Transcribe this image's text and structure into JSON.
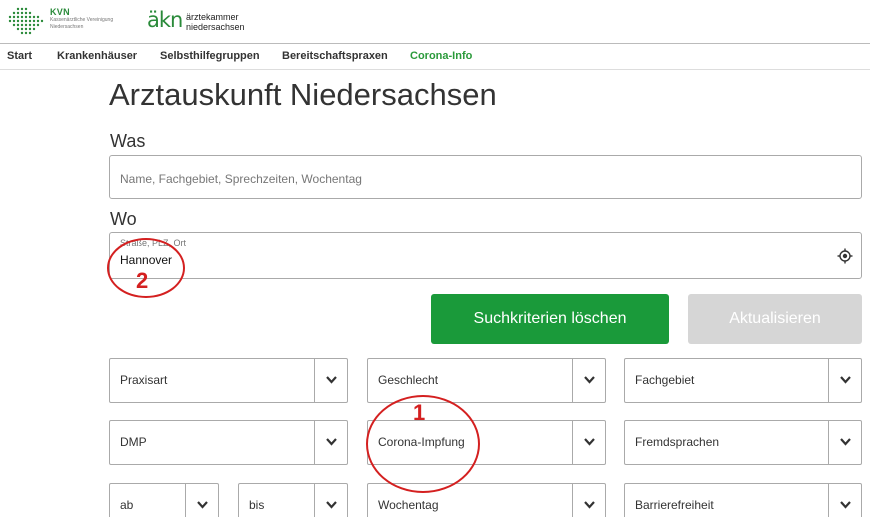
{
  "header": {
    "kvn_title": "KVN",
    "kvn_subtitle": "Kassenärztliche Vereinigung Niedersachsen",
    "akn_mark": "äkn",
    "akn_line1": "ärztekammer",
    "akn_line2": "niedersachsen"
  },
  "nav": {
    "items": [
      {
        "label": "Start"
      },
      {
        "label": "Krankenhäuser"
      },
      {
        "label": "Selbsthilfegruppen"
      },
      {
        "label": "Bereitschaftspraxen"
      },
      {
        "label": "Corona-Info"
      }
    ],
    "active_color": "#2a9a3a"
  },
  "main": {
    "title": "Arztauskunft Niedersachsen",
    "was_label": "Was",
    "was_placeholder": "Name, Fachgebiet, Sprechzeiten, Wochentag",
    "wo_label": "Wo",
    "wo_field_label": "Straße, PLZ, Ort",
    "wo_value": "Hannover",
    "btn_clear": "Suchkriterien löschen",
    "btn_update": "Aktualisieren"
  },
  "filters": {
    "praxisart": "Praxisart",
    "geschlecht": "Geschlecht",
    "fachgebiet": "Fachgebiet",
    "dmp": "DMP",
    "corona": "Corona-Impfung",
    "fremdsprachen": "Fremdsprachen",
    "ab": "ab",
    "bis": "bis",
    "wochentag": "Wochentag",
    "barrierefreiheit": "Barrierefreiheit"
  },
  "annotations": {
    "one": "1",
    "two": "2",
    "color": "#d42020"
  },
  "colors": {
    "brand_green": "#1a9a3a",
    "disabled_gray": "#d6d6d6"
  }
}
